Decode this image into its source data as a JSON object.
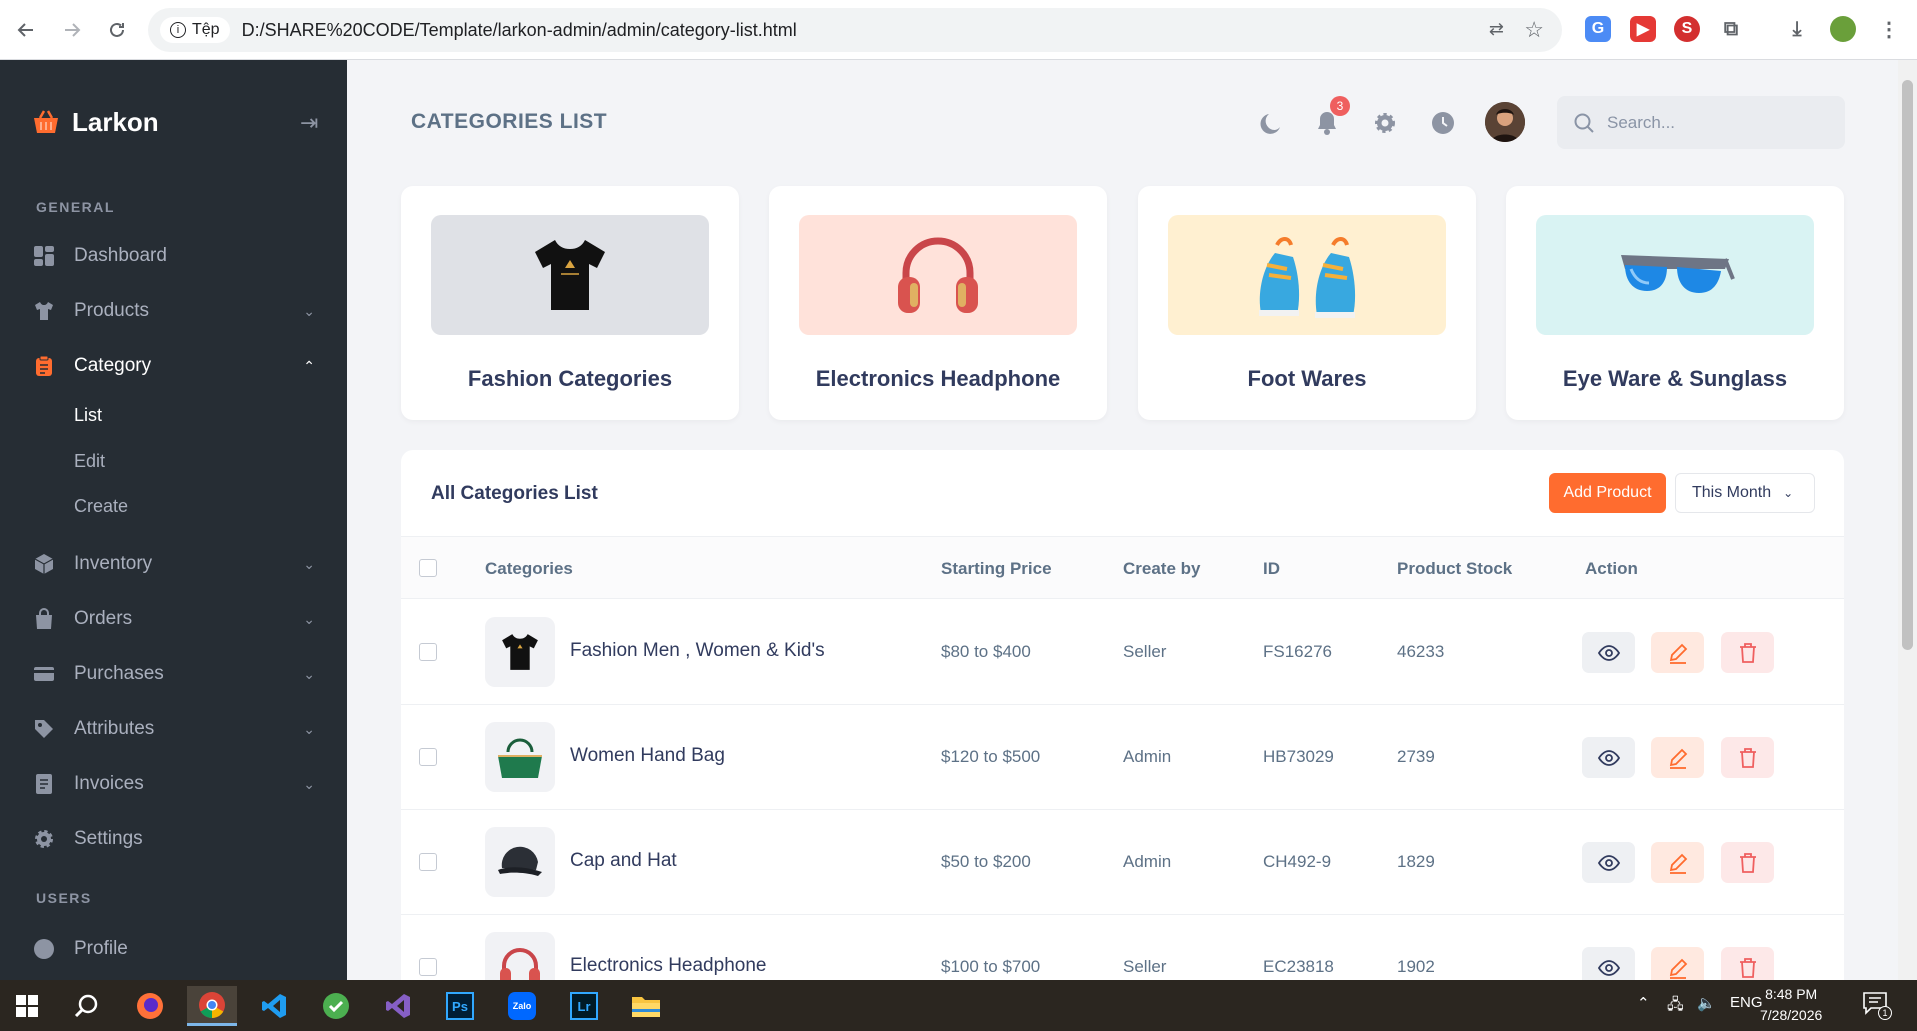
{
  "browser": {
    "site_label": "Tệp",
    "url": "D:/SHARE%20CODE/Template/larkon-admin/admin/category-list.html"
  },
  "sidebar": {
    "brand": "Larkon",
    "section_general": "GENERAL",
    "section_users": "USERS",
    "items": {
      "dashboard": "Dashboard",
      "products": "Products",
      "category": "Category",
      "list": "List",
      "edit": "Edit",
      "create": "Create",
      "inventory": "Inventory",
      "orders": "Orders",
      "purchases": "Purchases",
      "attributes": "Attributes",
      "invoices": "Invoices",
      "settings": "Settings",
      "profile": "Profile"
    }
  },
  "topbar": {
    "title": "CATEGORIES LIST",
    "notification_count": "3",
    "search_placeholder": "Search..."
  },
  "category_cards": [
    {
      "name": "Fashion Categories",
      "bg": "#dfe1e6"
    },
    {
      "name": "Electronics Headphone",
      "bg": "#ffe2da"
    },
    {
      "name": "Foot Wares",
      "bg": "#fff0d1"
    },
    {
      "name": "Eye Ware & Sunglass",
      "bg": "#d9f3f3"
    }
  ],
  "table": {
    "heading": "All Categories List",
    "add_button": "Add Product",
    "period": "This Month",
    "columns": {
      "categories": "Categories",
      "price": "Starting Price",
      "create_by": "Create by",
      "id": "ID",
      "stock": "Product Stock",
      "action": "Action"
    },
    "rows": [
      {
        "name": "Fashion Men , Women & Kid's",
        "price": "$80 to $400",
        "create_by": "Seller",
        "id": "FS16276",
        "stock": "46233"
      },
      {
        "name": "Women Hand Bag",
        "price": "$120 to $500",
        "create_by": "Admin",
        "id": "HB73029",
        "stock": "2739"
      },
      {
        "name": "Cap and Hat",
        "price": "$50 to $200",
        "create_by": "Admin",
        "id": "CH492-9",
        "stock": "1829"
      },
      {
        "name": "Electronics Headphone",
        "price": "$100 to $700",
        "create_by": "Seller",
        "id": "EC23818",
        "stock": "1902"
      }
    ]
  },
  "taskbar": {
    "language": "ENG",
    "time": "8:48 PM",
    "date": "7/28/2026",
    "notif_count": "1"
  },
  "colors": {
    "accent": "#ff6c2f",
    "sidebar_bg": "#262d34"
  }
}
